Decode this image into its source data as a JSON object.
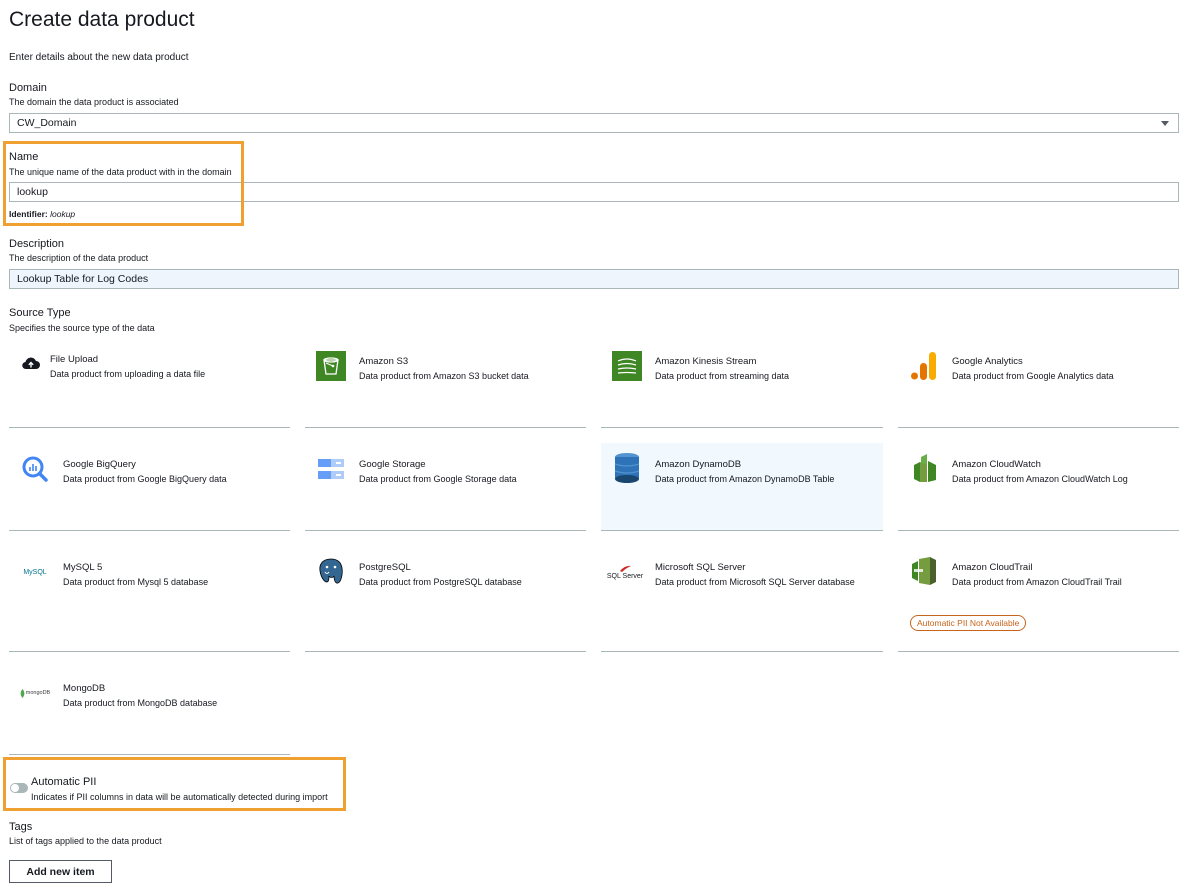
{
  "page": {
    "title": "Create data product",
    "description": "Enter details about the new data product"
  },
  "domain": {
    "label": "Domain",
    "description": "The domain the data product is associated",
    "value": "CW_Domain"
  },
  "name": {
    "label": "Name",
    "description": "The unique name of the data product with in the domain",
    "value": "lookup",
    "identifier_label": "Identifier:",
    "identifier_value": "lookup"
  },
  "description": {
    "label": "Description",
    "description": "The description of the data product",
    "value": "Lookup Table for Log Codes"
  },
  "source_type": {
    "label": "Source Type",
    "description": "Specifies the source type of the data",
    "selected": "Amazon DynamoDB",
    "options": [
      {
        "title": "File Upload",
        "desc": "Data product from uploading a data file",
        "icon": "cloud-upload-icon"
      },
      {
        "title": "Amazon S3",
        "desc": "Data product from Amazon S3 bucket data",
        "icon": "amazon-s3-icon"
      },
      {
        "title": "Amazon Kinesis Stream",
        "desc": "Data product from streaming data",
        "icon": "kinesis-icon"
      },
      {
        "title": "Google Analytics",
        "desc": "Data product from Google Analytics data",
        "icon": "google-analytics-icon"
      },
      {
        "title": "Google BigQuery",
        "desc": "Data product from Google BigQuery data",
        "icon": "bigquery-icon"
      },
      {
        "title": "Google Storage",
        "desc": "Data product from Google Storage data",
        "icon": "google-storage-icon"
      },
      {
        "title": "Amazon DynamoDB",
        "desc": "Data product from Amazon DynamoDB Table",
        "icon": "dynamodb-icon"
      },
      {
        "title": "Amazon CloudWatch",
        "desc": "Data product from Amazon CloudWatch Log",
        "icon": "cloudwatch-icon"
      },
      {
        "title": "MySQL 5",
        "desc": "Data product from Mysql 5 database",
        "icon": "mysql-icon",
        "icon_text": "MySQL"
      },
      {
        "title": "PostgreSQL",
        "desc": "Data product from PostgreSQL database",
        "icon": "postgresql-icon"
      },
      {
        "title": "Microsoft SQL Server",
        "desc": "Data product from Microsoft SQL Server database",
        "icon": "sql-server-icon",
        "icon_text": "SQL Server"
      },
      {
        "title": "Amazon CloudTrail",
        "desc": "Data product from Amazon CloudTrail Trail",
        "icon": "cloudtrail-icon",
        "badge": "Automatic PII Not Available"
      },
      {
        "title": "MongoDB",
        "desc": "Data product from MongoDB database",
        "icon": "mongodb-icon",
        "icon_text": "mongoDB"
      }
    ]
  },
  "pii": {
    "label": "Automatic PII",
    "description": "Indicates if PII columns in data will be automatically detected during import",
    "enabled": false
  },
  "tags": {
    "label": "Tags",
    "description": "List of tags applied to the data product",
    "add_label": "Add new item"
  },
  "colors": {
    "highlight": "#f0a030",
    "aws_green": "#3f8624",
    "dynamo_blue": "#2e73b8",
    "badge_orange": "#c7641c"
  }
}
